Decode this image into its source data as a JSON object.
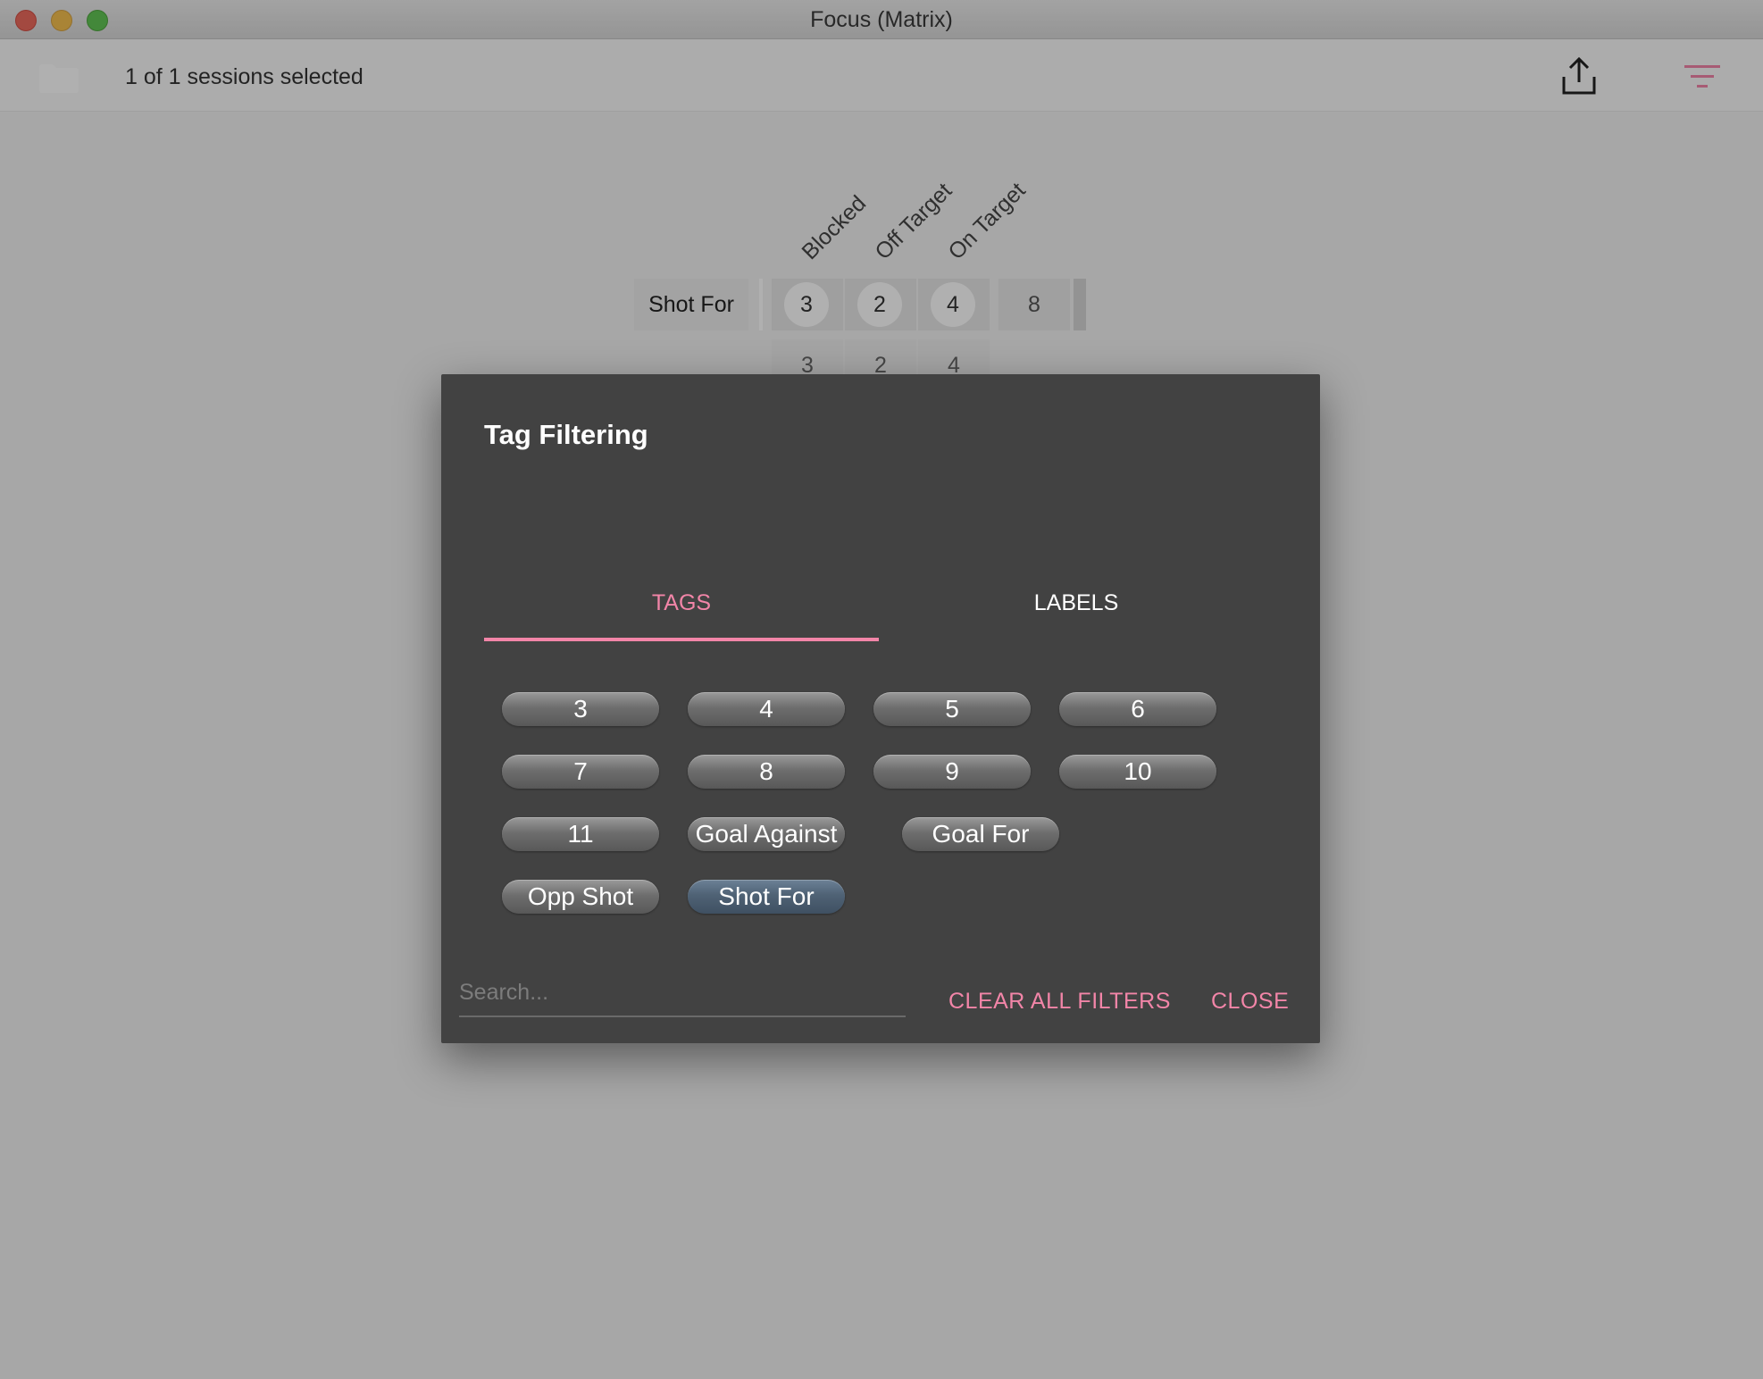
{
  "window": {
    "title": "Focus (Matrix)"
  },
  "toolbar": {
    "sessions_text": "1 of 1 sessions selected",
    "folder_icon": "folder-icon",
    "export_icon": "share-upload-icon",
    "filter_icon": "filter-icon",
    "accent_color": "#f285a8"
  },
  "matrix": {
    "columns": [
      "Blocked",
      "Off Target",
      "On Target"
    ],
    "row_label": "Shot For",
    "row_values": [
      "3",
      "2",
      "4"
    ],
    "row_total": "8",
    "column_totals": [
      "3",
      "2",
      "4"
    ]
  },
  "dialog": {
    "title": "Tag Filtering",
    "tabs": [
      {
        "label": "TAGS",
        "active": true
      },
      {
        "label": "LABELS",
        "active": false
      }
    ],
    "chips": [
      {
        "label": "3",
        "selected": false
      },
      {
        "label": "4",
        "selected": false
      },
      {
        "label": "5",
        "selected": false
      },
      {
        "label": "6",
        "selected": false
      },
      {
        "label": "7",
        "selected": false
      },
      {
        "label": "8",
        "selected": false
      },
      {
        "label": "9",
        "selected": false
      },
      {
        "label": "10",
        "selected": false
      },
      {
        "label": "11",
        "selected": false
      },
      {
        "label": "Goal Against",
        "selected": false
      },
      {
        "label": "Goal For",
        "selected": false
      },
      {
        "label": "Opp Shot",
        "selected": false
      },
      {
        "label": "Shot For",
        "selected": true
      }
    ],
    "search_placeholder": "Search...",
    "clear_label": "CLEAR ALL FILTERS",
    "close_label": "CLOSE"
  }
}
